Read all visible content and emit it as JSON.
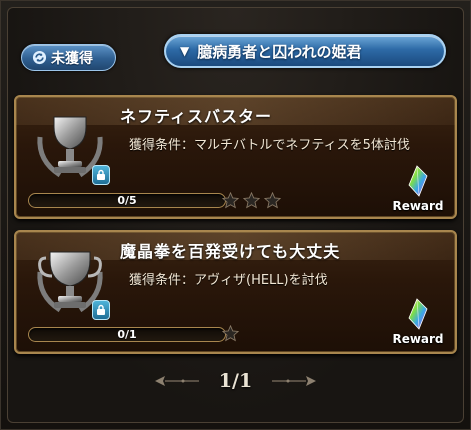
{
  "filter": {
    "status_label": "未獲得",
    "icon": "refresh-icon"
  },
  "category": {
    "selected": "臆病勇者と囚われの姫君",
    "icon": "triangle-down-icon"
  },
  "achievements": [
    {
      "title": "ネフティスバスター",
      "condition": "獲得条件：マルチバトルでネフティスを5体討伐",
      "progress_text": "0/5",
      "progress": 0,
      "stars": 3,
      "reward_label": "Reward",
      "locked": true
    },
    {
      "title": "魔晶拳を百発受けても大丈夫",
      "condition": "獲得条件：アヴィザ(HELL)を討伐",
      "progress_text": "0/1",
      "progress": 0,
      "stars": 1,
      "reward_label": "Reward",
      "locked": true
    }
  ],
  "pagination": {
    "text": "1/1"
  },
  "colors": {
    "card_border": "#a8864e",
    "pill_blue": "#2f5f91",
    "star_dark": "#2a2622"
  }
}
